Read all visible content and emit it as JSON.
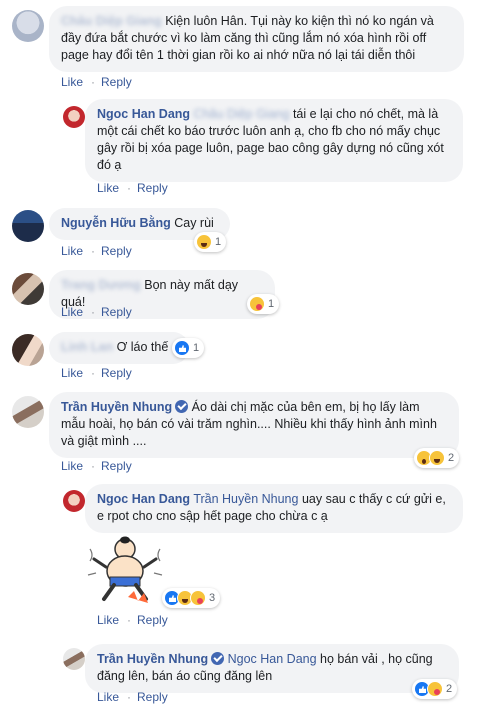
{
  "comments": [
    {
      "author": "Châu Diệp Giang",
      "text": "Kiện luôn Hân. Tụi này ko kiện thì nó ko ngán và đầy đứa bắt chước vì ko làm căng thì cũng lắm nó xóa hình rồi off page hay đổi tên 1 thời gian rồi ko ai nhớ nữa nó lại tái diễn thôi",
      "like": "Like",
      "reply": "Reply"
    },
    {
      "author": "Ngoc Han Dang",
      "tag": "Châu Diệp Giang",
      "text": "tái e lại cho nó chết, mà là một cái chết ko báo trước luôn anh ạ, cho fb cho nó mấy chục gây rồi bị xóa page luôn, page bao công gây dựng nó cũng xót đó ạ",
      "like": "Like",
      "reply": "Reply"
    },
    {
      "author": "Nguyễn Hữu Bằng",
      "text": "Cay rùi",
      "like": "Like",
      "reply": "Reply",
      "reaction_count": "1"
    },
    {
      "author": "Trang Dương",
      "text": "Bọn này mất dạy quá!",
      "like": "Like",
      "reply": "Reply",
      "reaction_count": "1"
    },
    {
      "author": "Linh Lan",
      "text": "Ơ láo thế",
      "like": "Like",
      "reply": "Reply",
      "reaction_count": "1"
    },
    {
      "author": "Trần Huyền Nhung",
      "text": "Áo dài chị mặc của bên em, bị họ lấy làm mẫu hoài, họ bán có vài trăm nghìn.... Nhiều khi thấy hình ảnh mình và giật mình ....",
      "like": "Like",
      "reply": "Reply",
      "reaction_count": "2"
    },
    {
      "author": "Ngoc Han Dang",
      "tag": "Trần Huyền Nhung",
      "text": "uay sau c thấy c cứ gửi e, e rpot cho cno sập hết page cho chừa c ạ",
      "like": "Like",
      "reply": "Reply",
      "reaction_count": "3"
    },
    {
      "author": "Trần Huyền Nhung",
      "tag": "Ngoc Han Dang",
      "text": "họ bán vải , họ cũng đăng lên, bán áo cũng đăng lên",
      "like": "Like",
      "reply": "Reply",
      "reaction_count": "2"
    }
  ],
  "separator": "·",
  "colors": {
    "link": "#385898",
    "bubble": "#f2f3f5",
    "like_blue": "#1877f2",
    "haha_yellow": "#f7c33a"
  }
}
